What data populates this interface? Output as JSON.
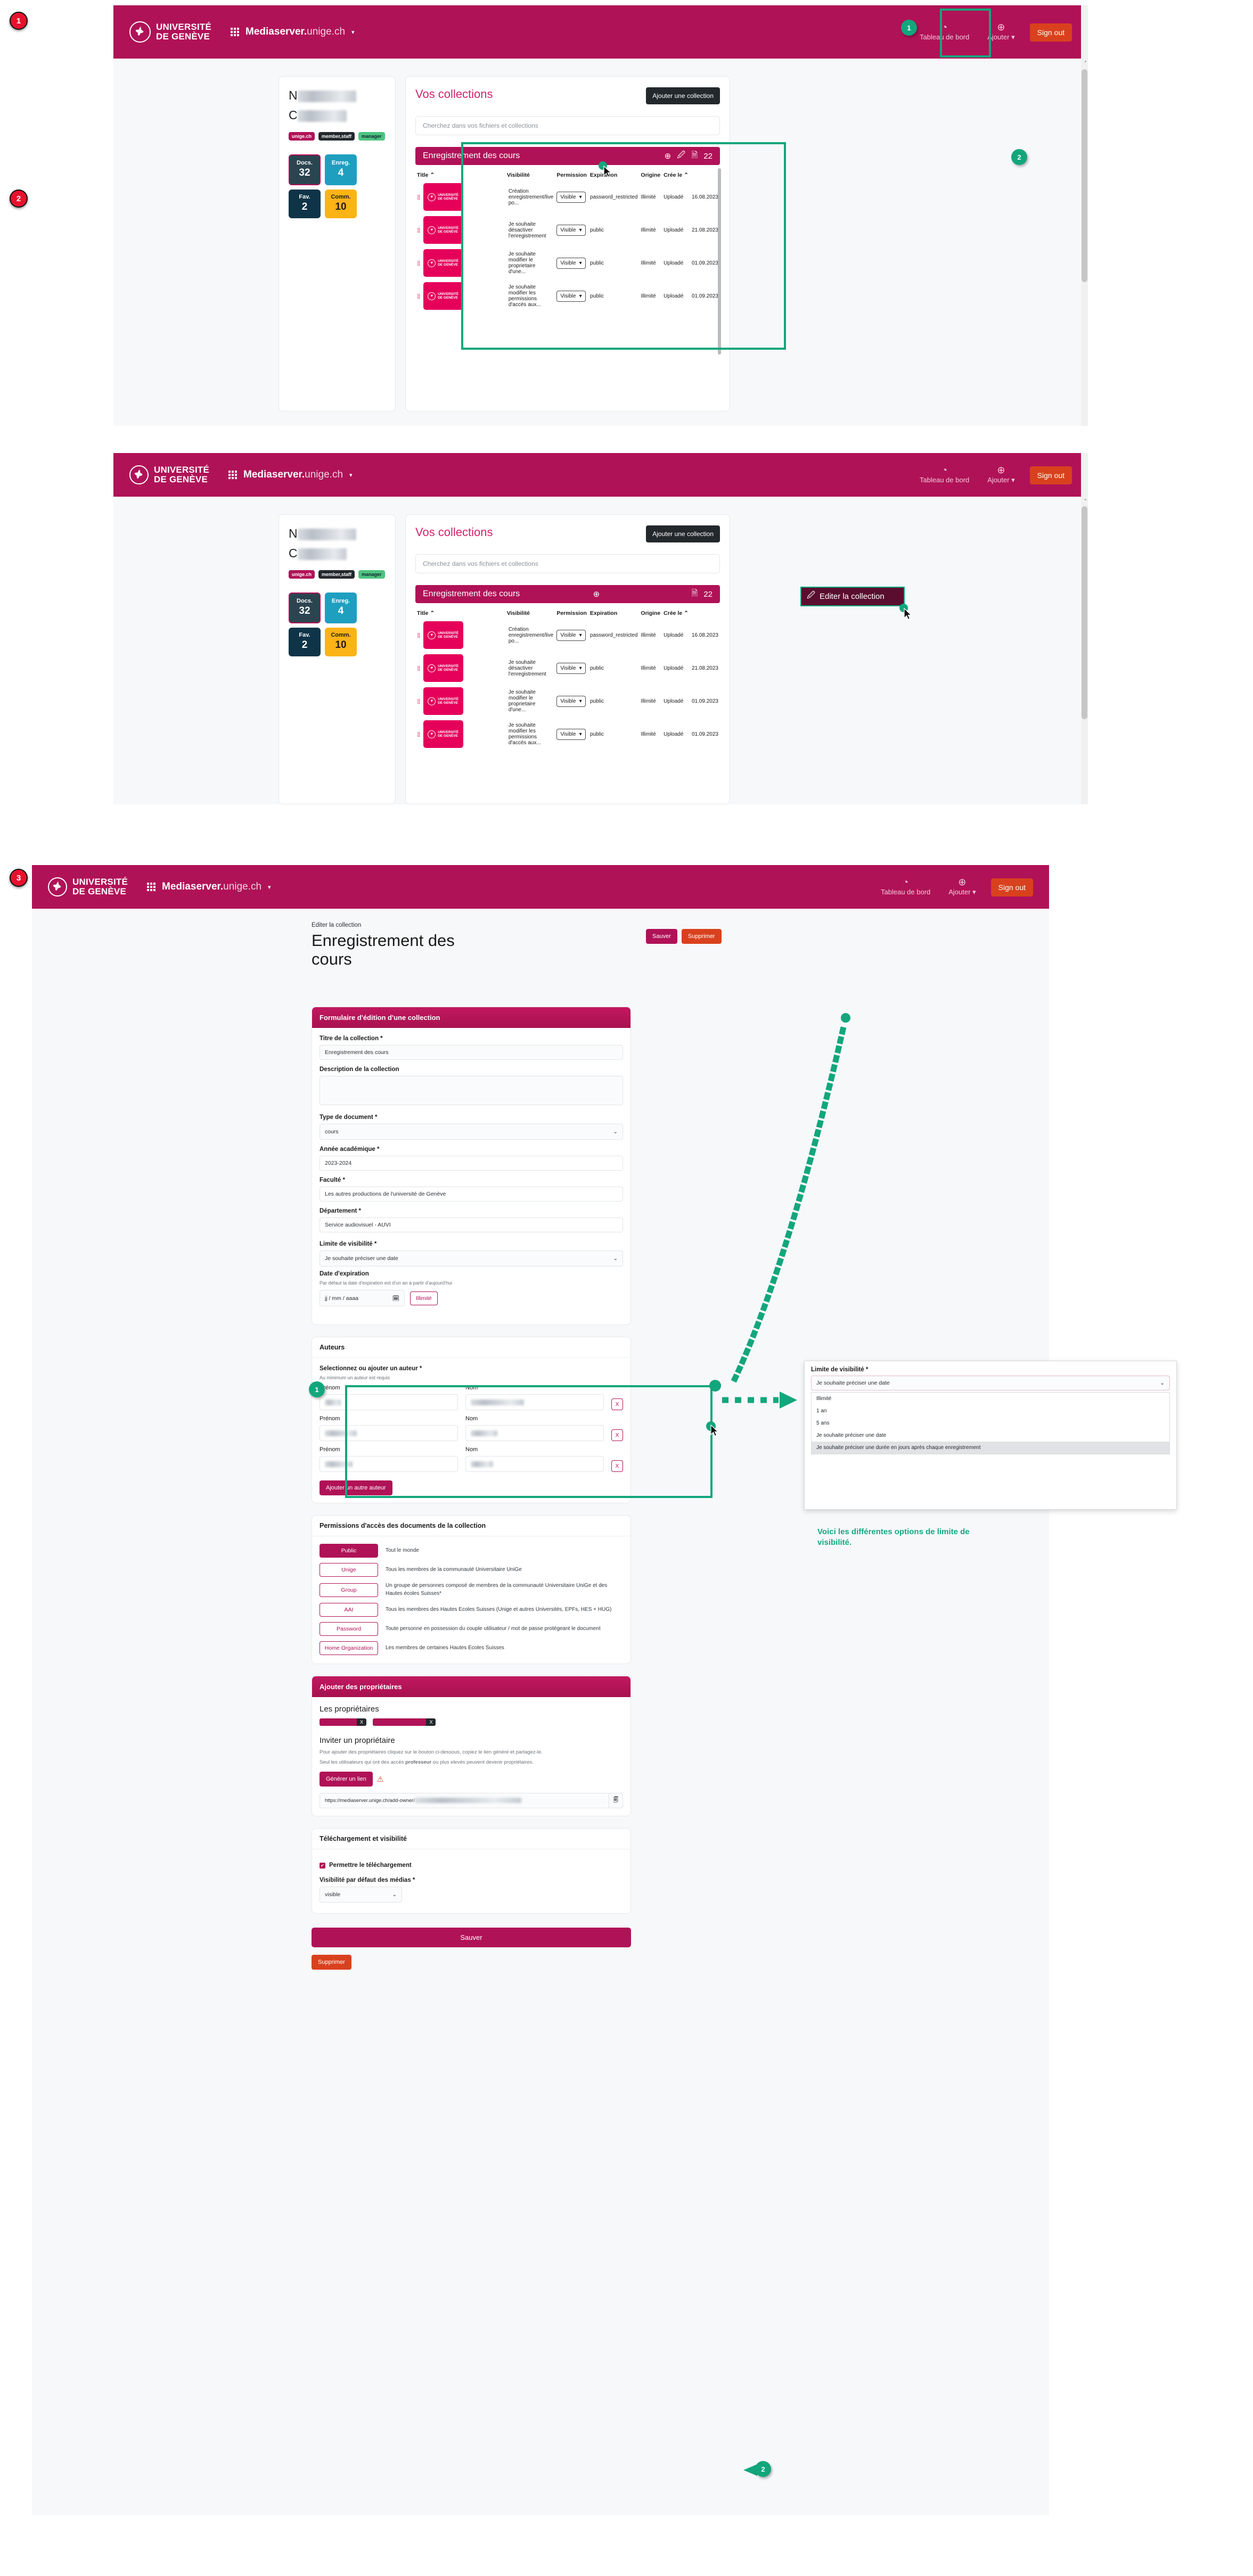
{
  "brand": {
    "university_line1": "UNIVERSITÉ",
    "university_line2": "DE GENÈVE",
    "app_name_bold": "Mediaserver.",
    "app_name_dim": "unige.ch",
    "caret": "▾"
  },
  "nav": {
    "dashboard": "Tableau de bord",
    "dashboard_icon": "dashboard-gauge-icon",
    "add": "Ajouter",
    "add_caret": "▾",
    "add_icon": "plus-circle-icon",
    "signout": "Sign out"
  },
  "profile": {
    "name_initial": "N",
    "second_initial": "C",
    "tags": [
      "unige.ch",
      "member,staff",
      "manager"
    ],
    "stats": [
      {
        "label": "Docs.",
        "value": "32"
      },
      {
        "label": "Enreg.",
        "value": "4"
      },
      {
        "label": "Fav.",
        "value": "2"
      },
      {
        "label": "Comm.",
        "value": "10"
      }
    ]
  },
  "collections": {
    "heading": "Vos collections",
    "add_button": "Ajouter une collection",
    "search_placeholder": "Cherchez dans vos fichiers et collections",
    "collection_title": "Enregistrement des cours",
    "doc_count": "22",
    "tools": {
      "add_icon": "plus-circle-icon",
      "edit_icon": "edit-pencil-icon",
      "file_icon": "document-icon"
    },
    "edit_tooltip": "Editer la collection",
    "columns": [
      "Title",
      "Visibilité",
      "Permission",
      "Expiration",
      "Origine",
      "Crée le"
    ],
    "sort_caret": "⌃",
    "rows": [
      {
        "title": "Création enregistrement/live po...",
        "visibility": "Visible",
        "permission": "password_restricted",
        "expiration": "Illimité",
        "origin": "Uploadé",
        "created": "16.08.2023"
      },
      {
        "title": "Je souhaite désactiver l'enregistrement",
        "visibility": "Visible",
        "permission": "public",
        "expiration": "Illimité",
        "origin": "Uploadé",
        "created": "21.08.2023"
      },
      {
        "title": "Je souhaite modifier le proprietaire d'une...",
        "visibility": "Visible",
        "permission": "public",
        "expiration": "Illimité",
        "origin": "Uploadé",
        "created": "01.09.2023"
      },
      {
        "title": "Je souhaite modifier les permissions d'accès aux...",
        "visibility": "Visible",
        "permission": "public",
        "expiration": "Illimité",
        "origin": "Uploadé",
        "created": "01.09.2023"
      }
    ],
    "thumb_caption1": "UNIVERSITÉ",
    "thumb_caption2": "DE GENÈVE"
  },
  "editor": {
    "breadcrumb": "Editer la collection",
    "page_title": "Enregistrement des cours",
    "save_top": "Sauver",
    "delete_top": "Supprimer",
    "form_header": "Formulaire d'édition d'une collection",
    "title_label": "Titre de la collection *",
    "title_value": "Enregistrement des cours",
    "description_label": "Description de la collection",
    "description_value": "",
    "doctype_label": "Type de document *",
    "doctype_value": "cours",
    "year_label": "Année académique *",
    "year_value": "2023-2024",
    "faculty_label": "Faculté *",
    "faculty_value": "Les autres productions de l'université de Genève",
    "department_label": "Département *",
    "department_value": "Service audiovisuel - AUVI",
    "visibility_limit_label": "Limite de visibilité *",
    "visibility_limit_value": "Je souhaite préciser une date",
    "expiration_label": "Date d'expiration",
    "expiration_help": "Par défaut la date d'expiration est d'un an à partir d'aujourd'hui",
    "date_placeholder": "jj / mm / aaaa",
    "date_icon": "calendar-icon",
    "illimite_button": "Illimité",
    "chevron": "⌄"
  },
  "dropdown": {
    "label": "Limite de visibilité *",
    "selected": "Je souhaite préciser une date",
    "options": [
      "Illimité",
      "1 an",
      "5 ans",
      "Je souhaite préciser une date",
      "Je souhaite préciser une durée en jours après chaque enregistrement"
    ],
    "highlighted_index": 4
  },
  "authors": {
    "card_title": "Auteurs",
    "section_label": "Selectionnez ou ajouter un auteur *",
    "help": "Au minimum un auteur est requis",
    "first_label": "Prénom",
    "last_label": "Nom",
    "remove_label": "X",
    "add_button": "Ajouter un autre auteur",
    "rows": 3
  },
  "permissions": {
    "card_title": "Permissions d'accès des documents de la collection",
    "items": [
      {
        "label": "Public",
        "desc": "Tout le monde",
        "active": true
      },
      {
        "label": "Unige",
        "desc": "Tous les membres de la communauté Universitaire UniGe",
        "active": false
      },
      {
        "label": "Group",
        "desc": "Un groupe de personnes composé de membres de la communauté Universitaire UniGe et des Hautes écoles Suisses*",
        "active": false
      },
      {
        "label": "AAI",
        "desc": "Tous les membres des Hautes Ecoles Suisses (Unige et autres Universités, EPFs, HES + HUG)",
        "active": false
      },
      {
        "label": "Password",
        "desc": "Toute personne en possession du couple utilisateur / mot de passe protégeant le document",
        "active": false
      },
      {
        "label": "Home Organization",
        "desc": "Les membres de certaines Hautes Ecoles Suisses",
        "active": false
      }
    ]
  },
  "owners": {
    "card_title": "Ajouter des propriétaires",
    "owners_label": "Les propriétaires",
    "chip_remove": "X",
    "invite_label": "Inviter un propriétaire",
    "invite_help1": "Pour ajouter des propriétaires cliquez sur le bouton ci-dessous, copiez le lien généré et partagez-le.",
    "invite_help2_pre": "Seul les utilisateurs qui ont des accès ",
    "invite_help2_bold": "professeur",
    "invite_help2_post": " ou plus elevés peuvent devenir propriétaires.",
    "generate_button": "Générer un lien",
    "warning_icon": "warning-triangle-icon",
    "link_value": "https://mediaserver.unige.ch/add-owner/",
    "copy_icon": "clipboard-copy-icon"
  },
  "download": {
    "card_title": "Téléchargement et visibilité",
    "checkbox_label": "Permettre le téléchargement",
    "checkbox_checked": true,
    "visibility_label": "Visibilité par défaut des médias *",
    "visibility_value": "visible"
  },
  "footer": {
    "save": "Sauver",
    "delete": "Supprimer"
  },
  "annotations": {
    "step1": "1",
    "step2": "2",
    "step3": "3",
    "green1": "1",
    "green2": "2",
    "green2b": "2",
    "green2c": "2",
    "note_visibility": "Voici les différentes options de limite de visibilité."
  },
  "colors": {
    "brand": "#b01257",
    "accent_green": "#12a67c",
    "orange": "#d9411e",
    "pink": "#d1236b"
  }
}
